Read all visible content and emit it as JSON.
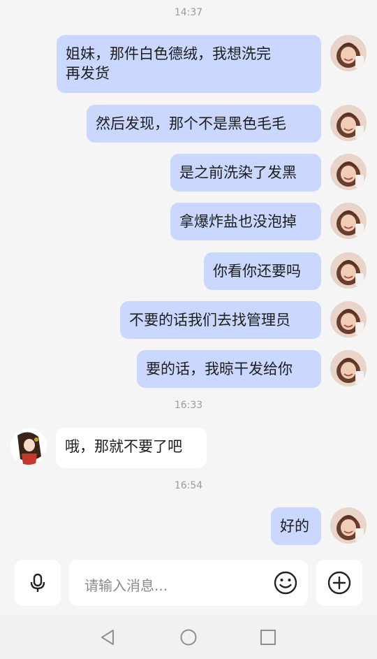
{
  "chat": {
    "timestamps": [
      "14:37",
      "16:33",
      "16:54"
    ],
    "messages": [
      {
        "side": "self",
        "text": "姐妹，那件白色德绒，我想洗完\n再发货"
      },
      {
        "side": "self",
        "text": "然后发现，那个不是黑色毛毛"
      },
      {
        "side": "self",
        "text": "是之前洗染了发黑"
      },
      {
        "side": "self",
        "text": "拿爆炸盐也没泡掉"
      },
      {
        "side": "self",
        "text": "你看你还要吗"
      },
      {
        "side": "self",
        "text": "不要的话我们去找管理员"
      },
      {
        "side": "self",
        "text": "要的话，我晾干发给你"
      },
      {
        "side": "other",
        "text": "哦，那就不要了吧"
      },
      {
        "side": "self",
        "text": "好的"
      }
    ]
  },
  "input": {
    "placeholder": "请输入消息...",
    "voice_icon": "microphone-icon",
    "emoji_icon": "smiley-icon",
    "add_icon": "plus-circle-icon"
  },
  "navbar": {
    "back_icon": "triangle-back-icon",
    "home_icon": "circle-home-icon",
    "recents_icon": "square-recents-icon"
  },
  "colors": {
    "sent_bubble": "#cad8ff",
    "received_bubble": "#ffffff",
    "background": "#f5f5f5"
  }
}
